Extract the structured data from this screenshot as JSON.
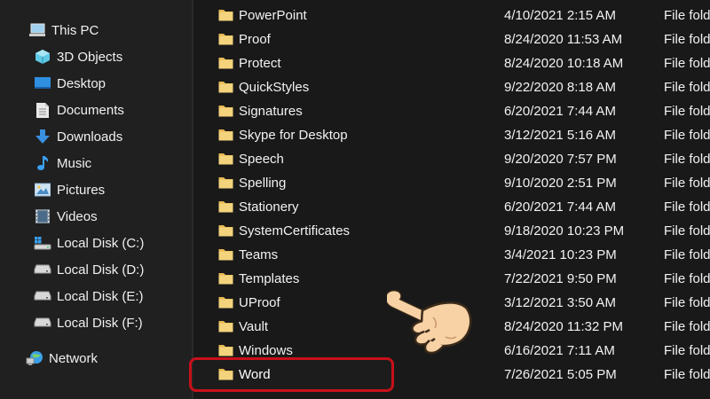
{
  "sidebar": {
    "items": [
      {
        "label": "This PC",
        "icon": "this-pc-icon"
      },
      {
        "label": "3D Objects",
        "icon": "3d-objects-icon"
      },
      {
        "label": "Desktop",
        "icon": "desktop-icon"
      },
      {
        "label": "Documents",
        "icon": "documents-icon"
      },
      {
        "label": "Downloads",
        "icon": "downloads-icon"
      },
      {
        "label": "Music",
        "icon": "music-icon"
      },
      {
        "label": "Pictures",
        "icon": "pictures-icon"
      },
      {
        "label": "Videos",
        "icon": "videos-icon"
      },
      {
        "label": "Local Disk (C:)",
        "icon": "windows-drive-icon"
      },
      {
        "label": "Local Disk (D:)",
        "icon": "drive-icon"
      },
      {
        "label": "Local Disk (E:)",
        "icon": "drive-icon"
      },
      {
        "label": "Local Disk (F:)",
        "icon": "drive-icon"
      },
      {
        "label": "Network",
        "icon": "network-icon"
      }
    ]
  },
  "files": {
    "rows": [
      {
        "name": "PowerPoint",
        "date": "4/10/2021 2:15 AM",
        "type": "File fold"
      },
      {
        "name": "Proof",
        "date": "8/24/2020 11:53 AM",
        "type": "File fold"
      },
      {
        "name": "Protect",
        "date": "8/24/2020 10:18 AM",
        "type": "File fold"
      },
      {
        "name": "QuickStyles",
        "date": "9/22/2020 8:18 AM",
        "type": "File fold"
      },
      {
        "name": "Signatures",
        "date": "6/20/2021 7:44 AM",
        "type": "File fold"
      },
      {
        "name": "Skype for Desktop",
        "date": "3/12/2021 5:16 AM",
        "type": "File fold"
      },
      {
        "name": "Speech",
        "date": "9/20/2020 7:57 PM",
        "type": "File fold"
      },
      {
        "name": "Spelling",
        "date": "9/10/2020 2:51 PM",
        "type": "File fold"
      },
      {
        "name": "Stationery",
        "date": "6/20/2021 7:44 AM",
        "type": "File fold"
      },
      {
        "name": "SystemCertificates",
        "date": "9/18/2020 10:23 PM",
        "type": "File fold"
      },
      {
        "name": "Teams",
        "date": "3/4/2021 10:23 PM",
        "type": "File fold"
      },
      {
        "name": "Templates",
        "date": "7/22/2021 9:50 PM",
        "type": "File fold"
      },
      {
        "name": "UProof",
        "date": "3/12/2021 3:50 AM",
        "type": "File fold"
      },
      {
        "name": "Vault",
        "date": "8/24/2020 11:32 PM",
        "type": "File fold"
      },
      {
        "name": "Windows",
        "date": "6/16/2021 7:11 AM",
        "type": "File fold"
      },
      {
        "name": "Word",
        "date": "7/26/2021 5:05 PM",
        "type": "File fold",
        "highlighted": true
      }
    ]
  },
  "annotation": {
    "highlight_color": "#c8101a",
    "pointer_icon": "pointing-hand-icon"
  },
  "colors": {
    "background": "#191919",
    "sidebar": "#202020",
    "folder": "#f3d37c",
    "text": "#f2f2f2"
  }
}
